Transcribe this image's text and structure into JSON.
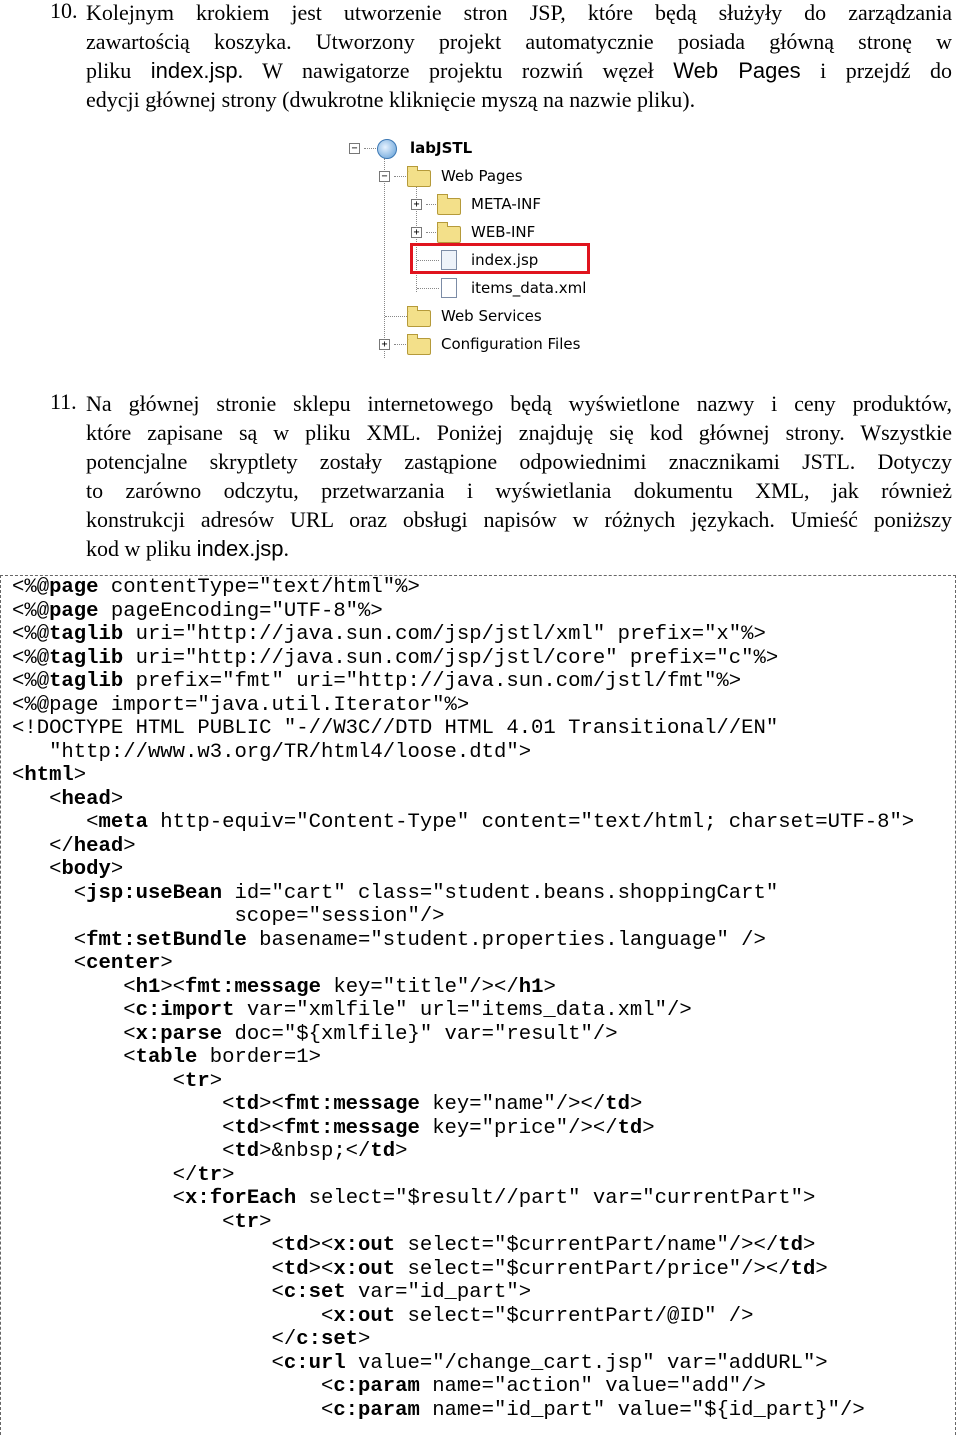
{
  "step10": {
    "number": "10.",
    "lines": [
      [
        "Kolejnym krokiem jest utworzenie stron JSP, które będą służyły do zarządzania"
      ],
      [
        "zawartością koszyka. Utworzony projekt automatycznie posiada główną stronę w"
      ],
      [
        "pliku ",
        "index.jsp",
        ". W nawigatorze projektu rozwiń węzeł ",
        "Web Pages",
        " i przejdź do"
      ],
      [
        "edycji głównej strony (dwukrotne kliknięcie myszą na nazwie pliku)."
      ]
    ]
  },
  "project_tree": {
    "root": "labJSTL",
    "web_pages": "Web Pages",
    "meta_inf": "META-INF",
    "web_inf": "WEB-INF",
    "index_jsp": "index.jsp",
    "items_data": "items_data.xml",
    "web_services": "Web Services",
    "config_files": "Configuration Files",
    "highlight_color": "#e0141e"
  },
  "step11": {
    "number": "11.",
    "lines": [
      [
        "Na głównej stronie sklepu internetowego będą wyświetlone nazwy i ceny produktów,"
      ],
      [
        "które zapisane są w pliku XML. Poniżej znajduję się kod głównej strony. Wszystkie"
      ],
      [
        "potencjalne skryptlety zostały zastąpione odpowiednimi znacznikami JSTL. Dotyczy"
      ],
      [
        "to zarówno odczytu, przetwarzania i wyświetlania dokumentu XML, jak również"
      ],
      [
        "konstrukcji adresów URL oraz obsługi napisów w różnych językach. Umieść poniższy"
      ],
      [
        "kod w pliku ",
        "index.jsp",
        "."
      ]
    ]
  },
  "code_lines": [
    [
      "<%@",
      "page",
      " contentType=\"text/html\"%>"
    ],
    [
      "<%@",
      "page",
      " pageEncoding=\"UTF-8\"%>"
    ],
    [
      "<%@",
      "taglib",
      " uri=\"http://java.sun.com/jsp/jstl/xml\" prefix=\"x\"%>"
    ],
    [
      "<%@",
      "taglib",
      " uri=\"http://java.sun.com/jsp/jstl/core\" prefix=\"c\"%>"
    ],
    [
      "<%@",
      "taglib",
      " prefix=\"fmt\" uri=\"http://java.sun.com/jstl/fmt\"%>"
    ],
    [
      "<%@page import=\"java.util.Iterator\"%>"
    ],
    [
      "<!DOCTYPE HTML PUBLIC \"-//W3C//DTD HTML 4.01 Transitional//EN\""
    ],
    [
      "   \"http://www.w3.org/TR/html4/loose.dtd\">"
    ],
    [
      "<",
      "html",
      ">"
    ],
    [
      "   <",
      "head",
      ">"
    ],
    [
      "      <",
      "meta",
      " http-equiv=\"Content-Type\" content=\"text/html; charset=UTF-8\">"
    ],
    [
      "   </",
      "head",
      ">"
    ],
    [
      "   <",
      "body",
      ">"
    ],
    [
      "     <",
      "jsp:useBean",
      " id=\"cart\" class=\"student.beans.shoppingCart\""
    ],
    [
      "                  scope=\"session\"/>"
    ],
    [
      "     <",
      "fmt:setBundle",
      " basename=\"student.properties.language\" />"
    ],
    [
      "     <",
      "center",
      ">"
    ],
    [
      "         <",
      "h1",
      "><",
      "fmt:message",
      " key=\"title\"/></",
      "h1",
      ">"
    ],
    [
      "         <",
      "c:import",
      " var=\"xmlfile\" url=\"items_data.xml\"/>"
    ],
    [
      "         <",
      "x:parse",
      " doc=\"${xmlfile}\" var=\"result\"/>"
    ],
    [
      "         <",
      "table",
      " border=1>"
    ],
    [
      "             <",
      "tr",
      ">"
    ],
    [
      "                 <",
      "td",
      "><",
      "fmt:message",
      " key=\"name\"/></",
      "td",
      ">"
    ],
    [
      "                 <",
      "td",
      "><",
      "fmt:message",
      " key=\"price\"/></",
      "td",
      ">"
    ],
    [
      "                 <",
      "td",
      ">&nbsp;</",
      "td",
      ">"
    ],
    [
      "             </",
      "tr",
      ">"
    ],
    [
      "             <",
      "x:forEach",
      " select=\"$result//part\" var=\"currentPart\">"
    ],
    [
      "                 <",
      "tr",
      ">"
    ],
    [
      "                     <",
      "td",
      "><",
      "x:out",
      " select=\"$currentPart/name\"/></",
      "td",
      ">"
    ],
    [
      "                     <",
      "td",
      "><",
      "x:out",
      " select=\"$currentPart/price\"/></",
      "td",
      ">"
    ],
    [
      "                     <",
      "c:set",
      " var=\"id_part\">"
    ],
    [
      "                         <",
      "x:out",
      " select=\"$currentPart/@ID\" />"
    ],
    [
      "                     </",
      "c:set",
      ">"
    ],
    [
      "                     <",
      "c:url",
      " value=\"/change_cart.jsp\" var=\"addURL\">"
    ],
    [
      "                         <",
      "c:param",
      " name=\"action\" value=\"add\"/>"
    ],
    [
      "                         <",
      "c:param",
      " name=\"id_part\" value=\"${id_part}\"/>"
    ]
  ]
}
